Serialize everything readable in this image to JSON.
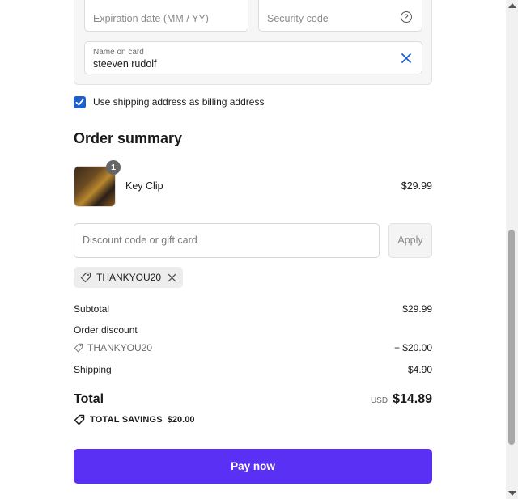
{
  "card_form": {
    "expiration_placeholder": "Expiration date (MM / YY)",
    "security_placeholder": "Security code",
    "name_label": "Name on card",
    "name_value": "steeven rudolf"
  },
  "billing": {
    "checkbox_label": "Use shipping address as billing address",
    "checked": true
  },
  "summary": {
    "title": "Order summary",
    "product": {
      "name": "Key Clip",
      "price": "$29.99",
      "quantity": "1"
    },
    "discount_placeholder": "Discount code or gift card",
    "apply_label": "Apply",
    "applied_code": "THANKYOU20",
    "subtotal_label": "Subtotal",
    "subtotal_value": "$29.99",
    "order_discount_label": "Order discount",
    "discount_code": "THANKYOU20",
    "discount_value": "− $20.00",
    "shipping_label": "Shipping",
    "shipping_value": "$4.90",
    "total_label": "Total",
    "currency": "USD",
    "total_value": "$14.89",
    "savings_label": "TOTAL SAVINGS",
    "savings_value": "$20.00"
  },
  "pay_button": "Pay now",
  "colors": {
    "accent": "#5a31f4",
    "checkbox": "#1d5fce",
    "clear_icon": "#1d5fce"
  }
}
